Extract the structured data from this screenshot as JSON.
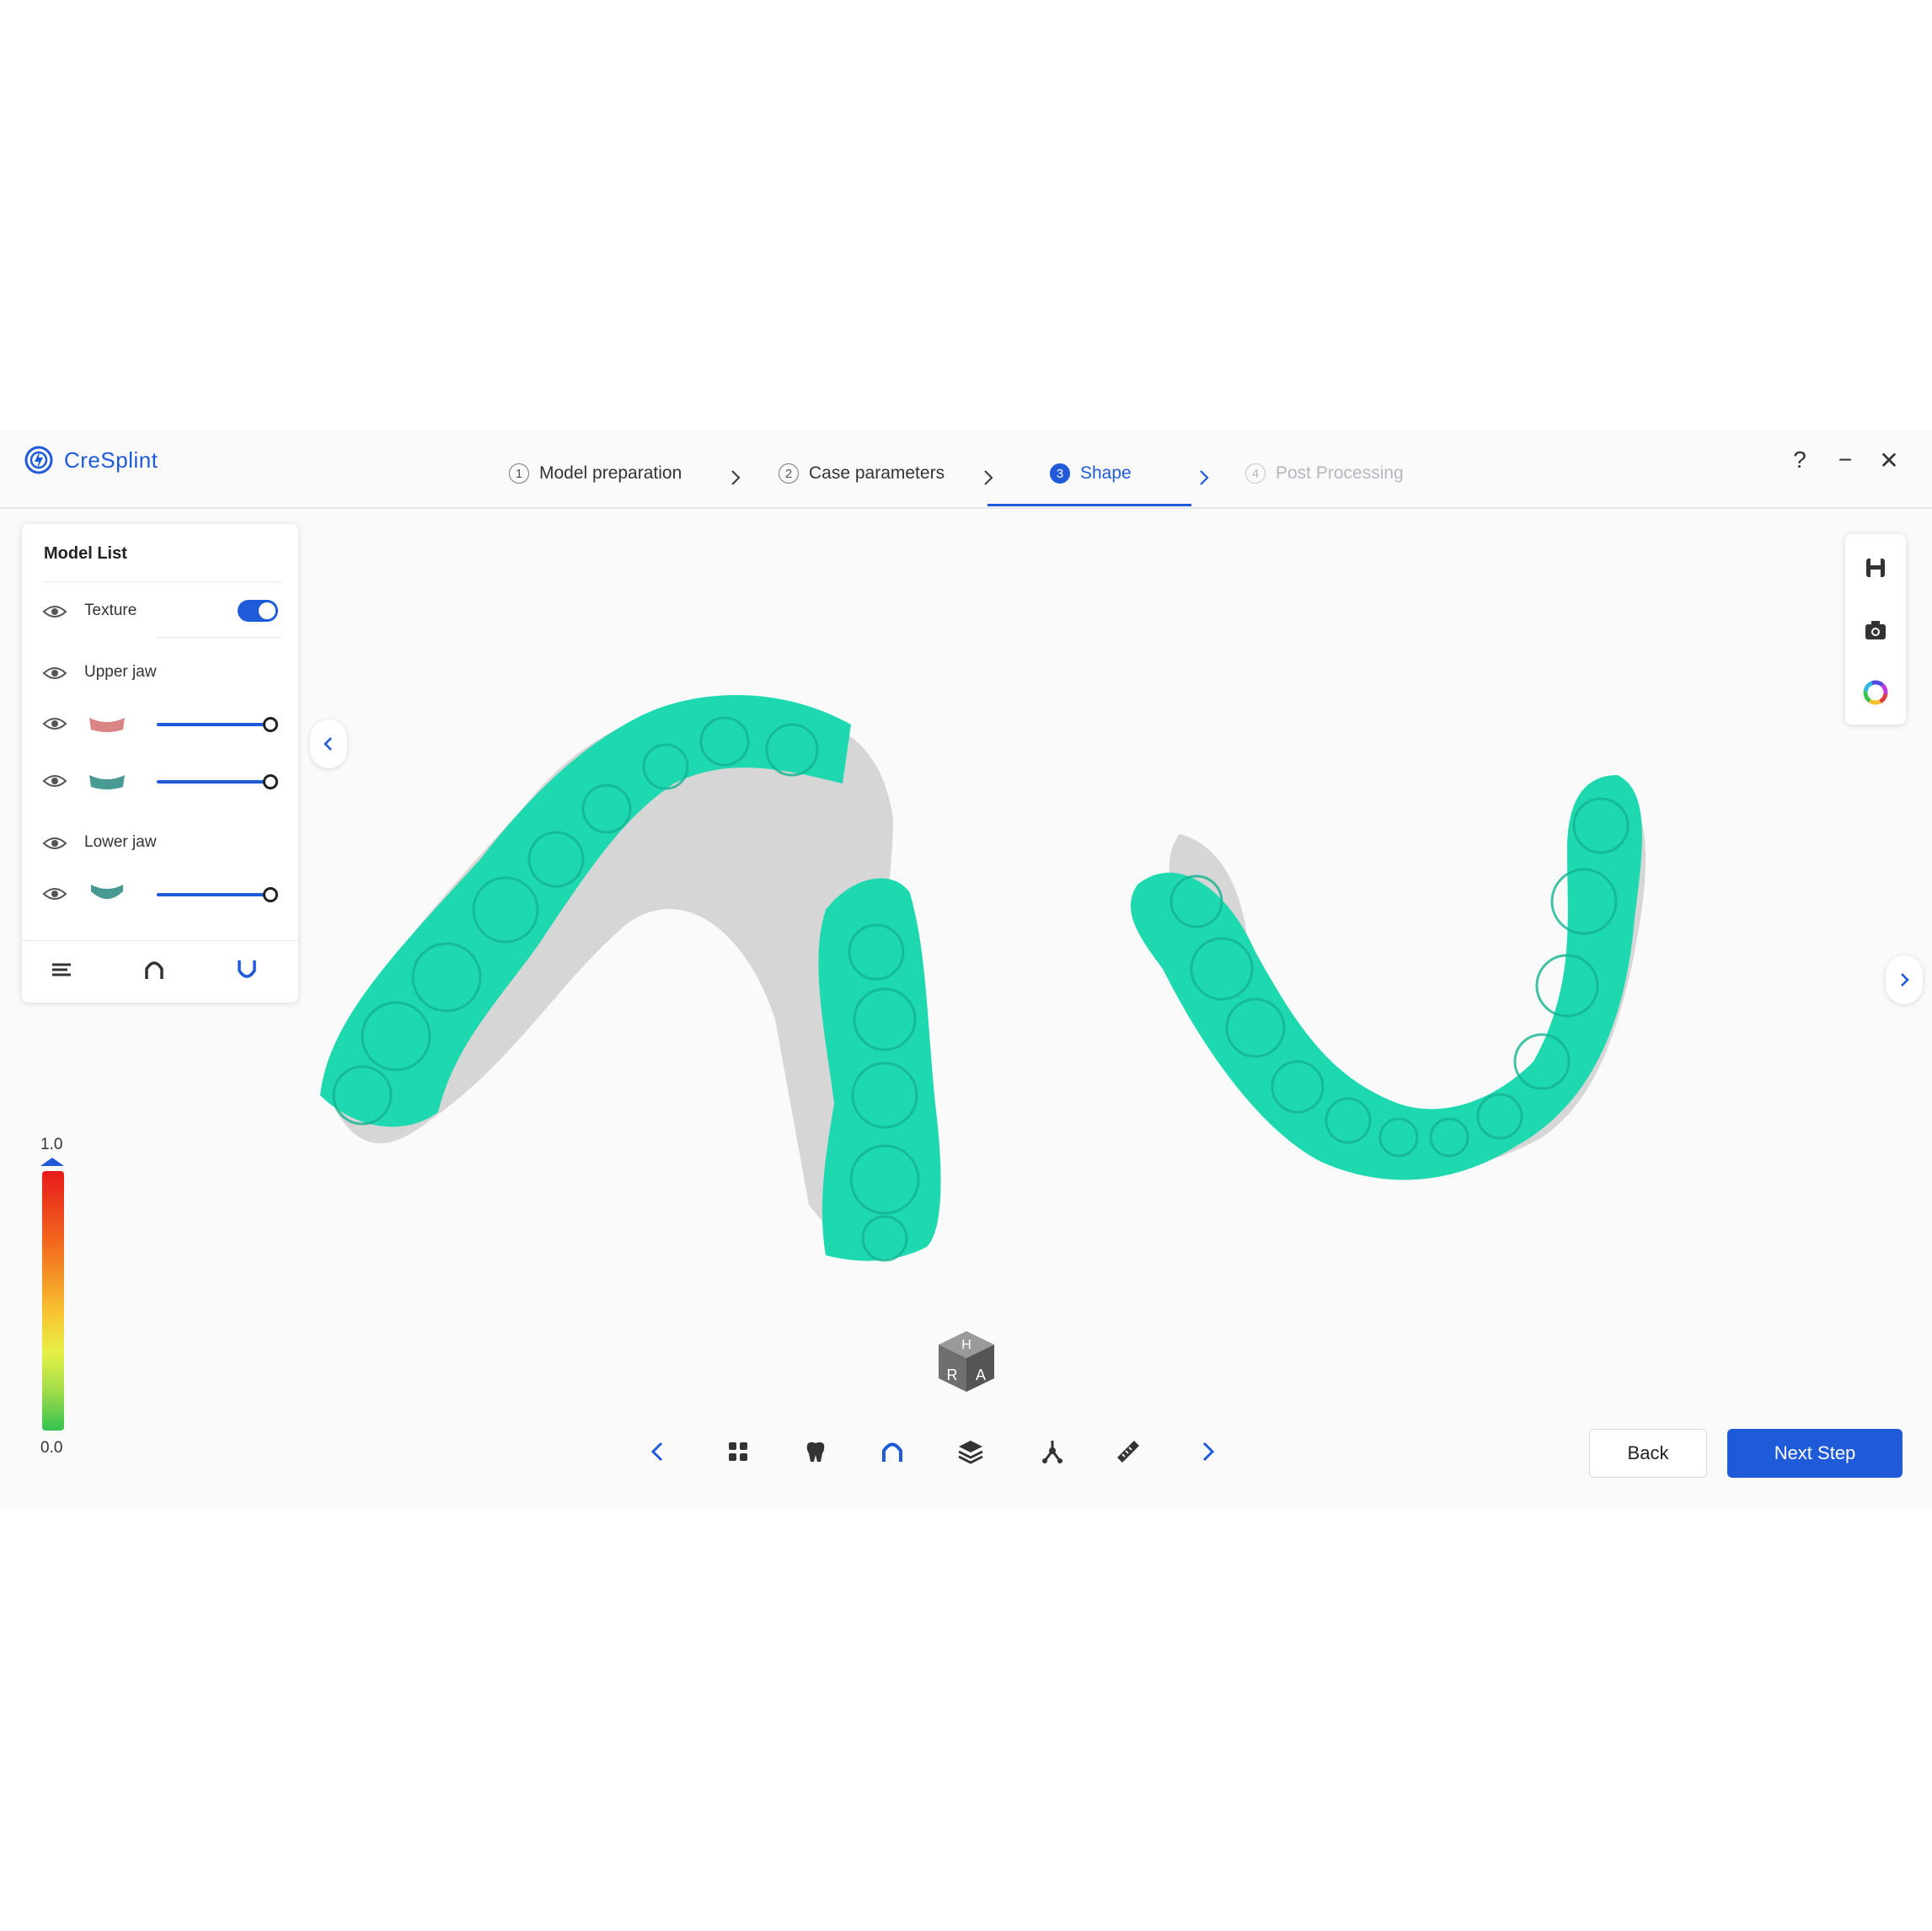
{
  "app": {
    "title": "CreSplint",
    "accent_color": "#1f5bd8"
  },
  "steps": [
    {
      "number": "1",
      "label": "Model preparation",
      "state": "done"
    },
    {
      "number": "2",
      "label": "Case parameters",
      "state": "done"
    },
    {
      "number": "3",
      "label": "Shape",
      "state": "active"
    },
    {
      "number": "4",
      "label": "Post Processing",
      "state": "disabled"
    }
  ],
  "window_controls": {
    "help": "?",
    "minimize": "−",
    "close": "✕"
  },
  "model_list": {
    "title": "Model List",
    "texture": {
      "label": "Texture",
      "enabled": true
    },
    "upper_jaw": {
      "label": "Upper jaw",
      "layers": [
        {
          "icon": "upper-gum-thumbnail",
          "opacity": 1.0
        },
        {
          "icon": "upper-splint-thumbnail",
          "opacity": 1.0
        }
      ]
    },
    "lower_jaw": {
      "label": "Lower jaw",
      "layers": [
        {
          "icon": "lower-splint-thumbnail",
          "opacity": 1.0
        }
      ]
    },
    "bottom_icons": [
      "list-settings-icon",
      "upper-arch-icon",
      "lower-arch-icon"
    ]
  },
  "right_toolbar": [
    "save-icon",
    "camera-icon",
    "color-wheel-icon"
  ],
  "color_scale": {
    "max_label": "1.0",
    "min_label": "0.0"
  },
  "nav_cube": {
    "top": "H",
    "left": "R",
    "right": "A"
  },
  "bottom_toolbar": [
    "chevron-left-icon",
    "grid-icon",
    "tooth-icon",
    "arch-icon",
    "layers-icon",
    "branch-icon",
    "ruler-icon",
    "chevron-right-icon"
  ],
  "buttons": {
    "back": "Back",
    "next": "Next Step"
  },
  "colors": {
    "splint": "#1ed8b0",
    "model": "#d8d8d8"
  }
}
